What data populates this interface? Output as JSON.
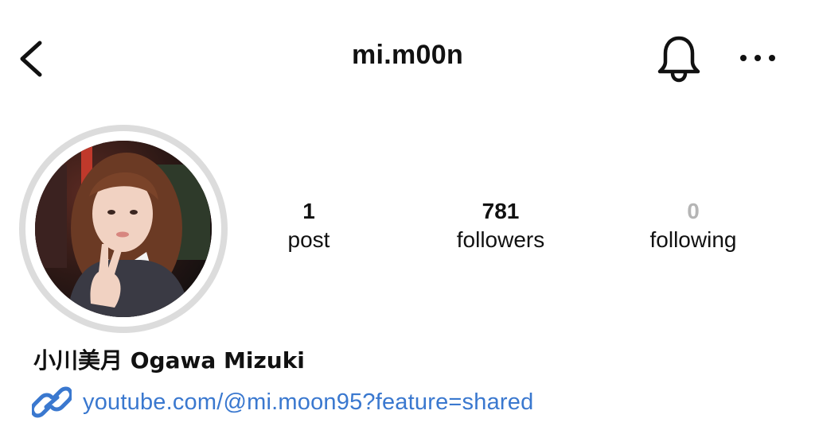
{
  "header": {
    "username": "mi.m00n",
    "back_icon": "chevron-left-icon",
    "bell_icon": "bell-icon",
    "more_icon": "more-horizontal-icon"
  },
  "profile": {
    "avatar_icon": "profile-photo",
    "stats": {
      "posts": {
        "count": "1",
        "label": "post"
      },
      "followers": {
        "count": "781",
        "label": "followers"
      },
      "following": {
        "count": "0",
        "label": "following"
      }
    },
    "display_name": "小川美月 Ogawa Mizuki",
    "link": {
      "icon": "link-icon",
      "text": "youtube.com/@mi.moon95?feature=shared"
    }
  },
  "colors": {
    "text": "#111111",
    "muted": "#b5b5b5",
    "link": "#3a78cf",
    "avatar_ring": "#dcdcdc"
  }
}
